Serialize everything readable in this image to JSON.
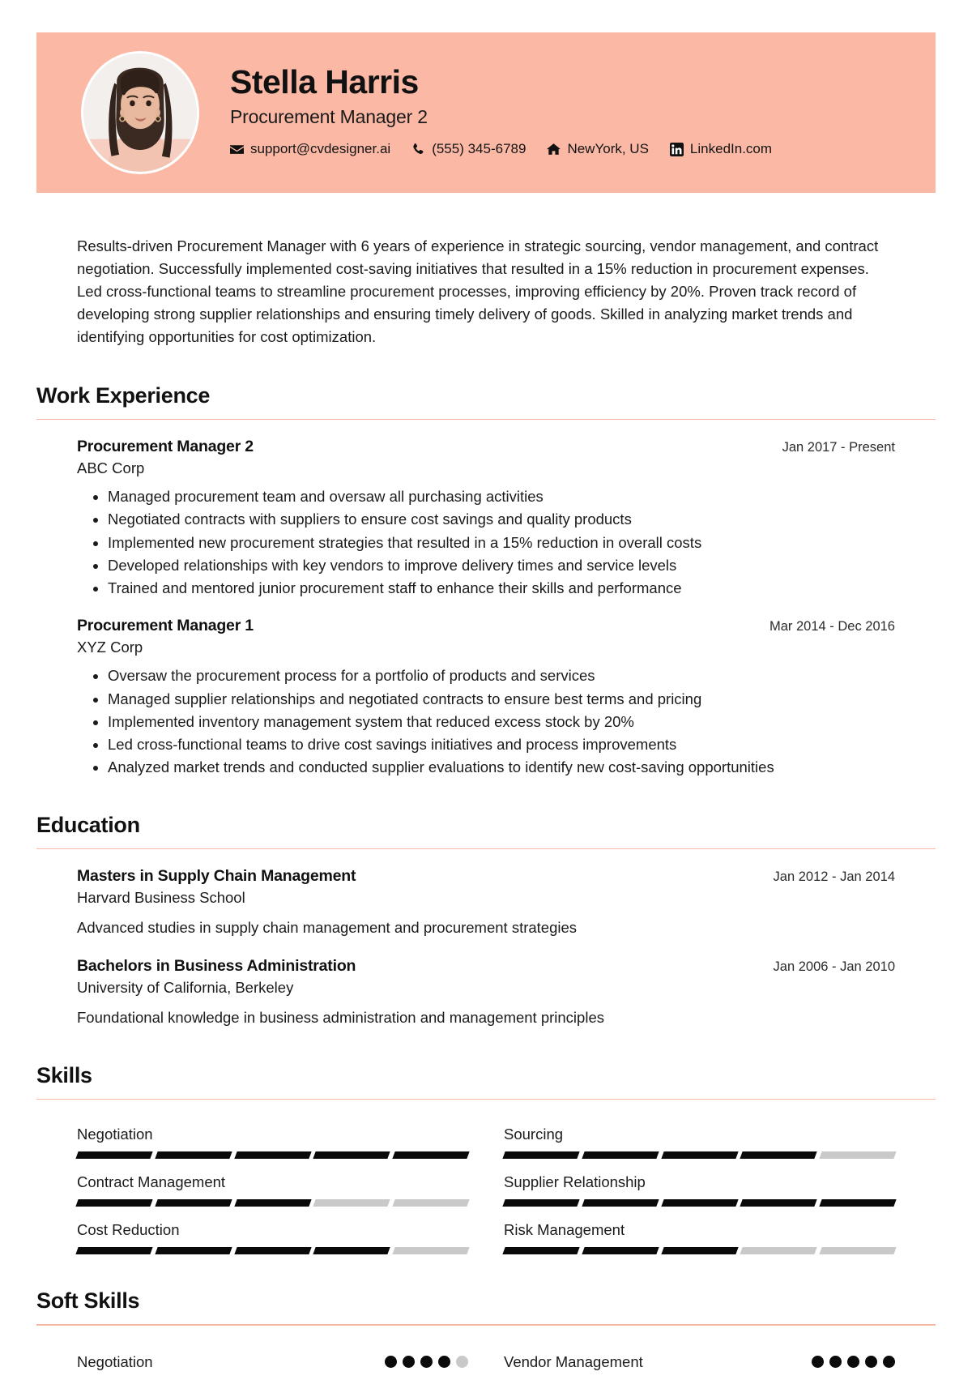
{
  "theme": {
    "header_bg": "#fbb8a5",
    "divider": "#f6b9a4",
    "filled": "#0a0a0a",
    "empty": "#c9c9c9"
  },
  "header": {
    "name": "Stella Harris",
    "role": "Procurement Manager 2",
    "contacts": [
      {
        "icon": "envelope-icon",
        "text": "support@cvdesigner.ai"
      },
      {
        "icon": "phone-icon",
        "text": "(555) 345-6789"
      },
      {
        "icon": "home-icon",
        "text": "NewYork, US"
      },
      {
        "icon": "linkedin-icon",
        "text": "LinkedIn.com"
      }
    ]
  },
  "summary": {
    "text": "Results-driven Procurement Manager with 6 years of experience in strategic sourcing, vendor management, and contract negotiation. Successfully implemented cost-saving initiatives that resulted in a 15% reduction in procurement expenses. Led cross-functional teams to streamline procurement processes, improving efficiency by 20%. Proven track record of developing strong supplier relationships and ensuring timely delivery of goods. Skilled in analyzing market trends and identifying opportunities for cost optimization."
  },
  "work_experience": {
    "title": "Work Experience",
    "entries": [
      {
        "title": "Procurement Manager 2",
        "org": "ABC Corp",
        "date": "Jan 2017 - Present",
        "bullets": [
          "Managed procurement team and oversaw all purchasing activities",
          "Negotiated contracts with suppliers to ensure cost savings and quality products",
          "Implemented new procurement strategies that resulted in a 15% reduction in overall costs",
          "Developed relationships with key vendors to improve delivery times and service levels",
          "Trained and mentored junior procurement staff to enhance their skills and performance"
        ]
      },
      {
        "title": "Procurement Manager 1",
        "org": "XYZ Corp",
        "date": "Mar 2014 - Dec 2016",
        "bullets": [
          "Oversaw the procurement process for a portfolio of products and services",
          "Managed supplier relationships and negotiated contracts to ensure best terms and pricing",
          "Implemented inventory management system that reduced excess stock by 20%",
          "Led cross-functional teams to drive cost savings initiatives and process improvements",
          "Analyzed market trends and conducted supplier evaluations to identify new cost-saving opportunities"
        ]
      }
    ]
  },
  "education": {
    "title": "Education",
    "entries": [
      {
        "title": "Masters in Supply Chain Management",
        "org": "Harvard Business School",
        "date": "Jan 2012 - Jan 2014",
        "desc": "Advanced studies in supply chain management and procurement strategies"
      },
      {
        "title": "Bachelors in Business Administration",
        "org": "University of California, Berkeley",
        "date": "Jan 2006 - Jan 2010",
        "desc": "Foundational knowledge in business administration and management principles"
      }
    ]
  },
  "skills": {
    "title": "Skills",
    "max": 5,
    "items": [
      {
        "label": "Negotiation",
        "level": 5
      },
      {
        "label": "Sourcing",
        "level": 4
      },
      {
        "label": "Contract Management",
        "level": 3
      },
      {
        "label": "Supplier Relationship",
        "level": 5
      },
      {
        "label": "Cost Reduction",
        "level": 4
      },
      {
        "label": "Risk Management",
        "level": 3
      }
    ]
  },
  "soft_skills": {
    "title": "Soft Skills",
    "max": 5,
    "items": [
      {
        "label": "Negotiation",
        "level": 4
      },
      {
        "label": "Vendor Management",
        "level": 5
      }
    ]
  }
}
